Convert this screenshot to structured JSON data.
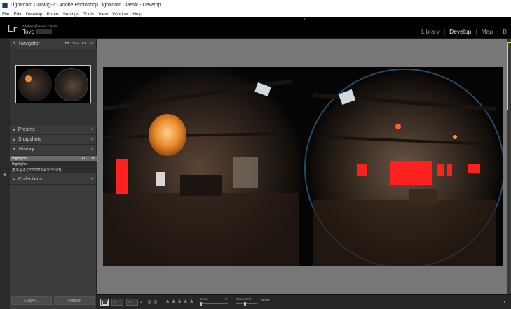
{
  "window": {
    "title": "Lightroom Catalog-2 - Adobe Photoshop Lightroom Classic - Develop"
  },
  "menubar": {
    "items": [
      "File",
      "Edit",
      "Develop",
      "Photo",
      "Settings",
      "Tools",
      "View",
      "Window",
      "Help"
    ]
  },
  "identity": {
    "logo": "Lr",
    "product": "Adobe Lightroom Classic",
    "user": "Toyo"
  },
  "modules": {
    "items": [
      "Library",
      "Develop",
      "Map",
      "B"
    ],
    "active": "Develop"
  },
  "navigator": {
    "title": "Navigator",
    "options": [
      "FIT",
      "FILL",
      "1:1",
      "4:1"
    ]
  },
  "panels": {
    "presets": "Presets",
    "snapshots": "Snapshots",
    "history": "History",
    "collections": "Collections"
  },
  "history": {
    "rows": [
      {
        "label": "Highlights",
        "before": "+1",
        "after": "0"
      },
      {
        "label": "Highlights",
        "before": "",
        "after": ""
      },
      {
        "label": "読み込み (2020/01/04 20:57:01)",
        "before": "",
        "after": ""
      }
    ]
  },
  "buttons": {
    "copy": "Copy...",
    "paste": "Paste"
  },
  "toolbar": {
    "compare_label": "XY",
    "survey_label": "YY",
    "stars": "★★★★★",
    "zoom_label": "Zoom",
    "fit_label": "Fit",
    "grid_label": "Show Grid :",
    "grid_value": "Never",
    "progress": {
      "zoom": 0,
      "grid": 0.4
    }
  },
  "colors": {
    "lantern": "#e88a2b",
    "clip_warning": "#ff2020",
    "focus_outline": "#f0e000"
  }
}
